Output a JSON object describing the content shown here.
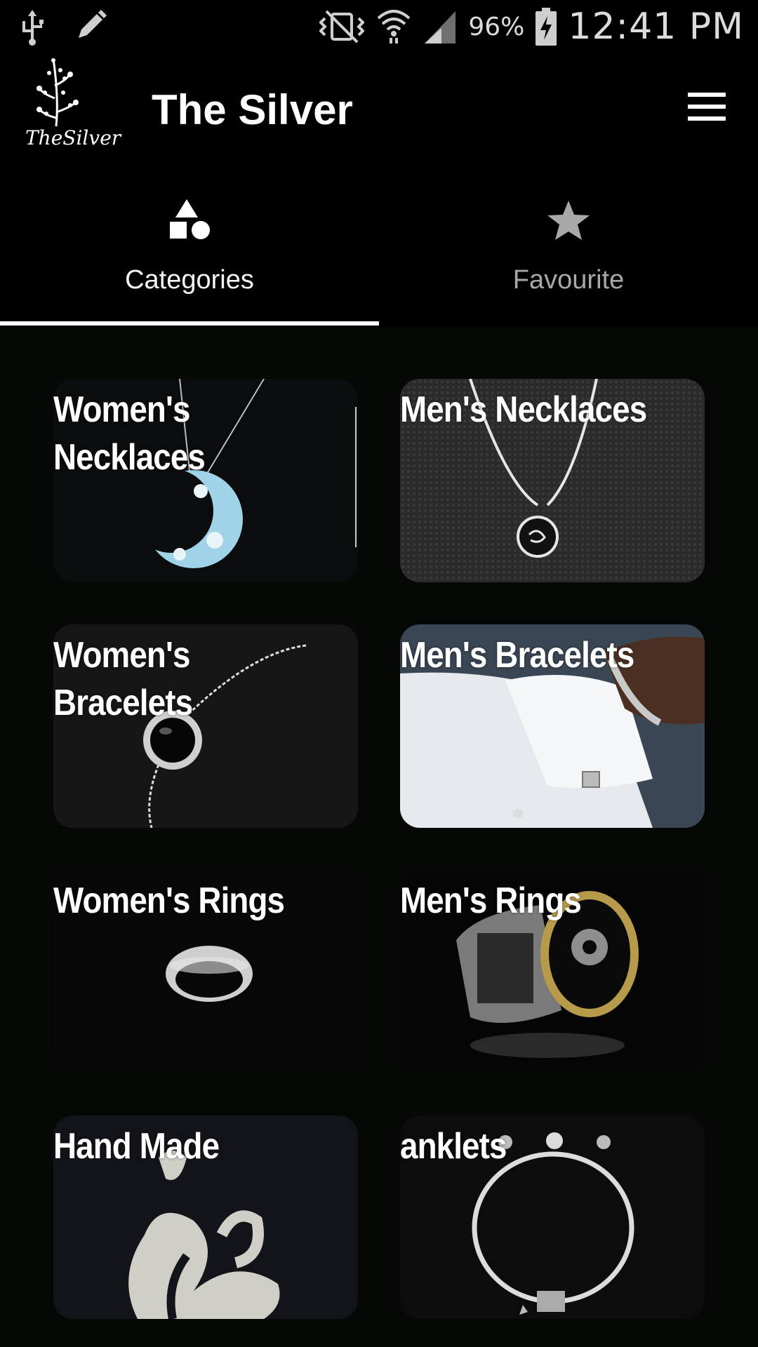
{
  "status_bar": {
    "battery_percent": "96%",
    "time": "12:41 PM",
    "icons": [
      "usb-icon",
      "pencil-icon",
      "vibrate-mute-icon",
      "wifi-icon",
      "signal-icon",
      "battery-charging-icon"
    ]
  },
  "app_bar": {
    "logo_text": "TheSilver",
    "title": "The Silver",
    "menu_icon": "hamburger-menu-icon"
  },
  "tabs": [
    {
      "label": "Categories",
      "icon": "shapes-icon",
      "selected": true
    },
    {
      "label": "Favourite",
      "icon": "star-icon",
      "selected": false
    }
  ],
  "categories": [
    {
      "label": "Women's Necklaces",
      "line1": "Women's",
      "line2": "Necklaces",
      "image": "crescent-moon-pendant"
    },
    {
      "label": "Men's Necklaces",
      "line1": "Men's Necklaces",
      "line2": "",
      "image": "round-pendant-on-knit"
    },
    {
      "label": "Women's Bracelets",
      "line1": "Women's",
      "line2": "Bracelets",
      "image": "gem-bracelet"
    },
    {
      "label": "Men's Bracelets",
      "line1": "Men's Bracelets",
      "line2": "",
      "image": "wrist-with-cufflink"
    },
    {
      "label": "Women's Rings",
      "line1": "Women's Rings",
      "line2": "",
      "image": "pave-band-ring"
    },
    {
      "label": "Men's Rings",
      "line1": "Men's Rings",
      "line2": "",
      "image": "onyx-signet-ring"
    },
    {
      "label": "Hand Made",
      "line1": "Hand Made",
      "line2": "",
      "image": "calligraphy-pendant"
    },
    {
      "label": "anklets",
      "line1": "anklets",
      "line2": "",
      "image": "bangle-anklet"
    }
  ],
  "colors": {
    "background": "#050805",
    "app_bar": "#000000",
    "text": "#ffffff",
    "tab_inactive": "#a8a8a8",
    "indicator": "#ffffff"
  }
}
